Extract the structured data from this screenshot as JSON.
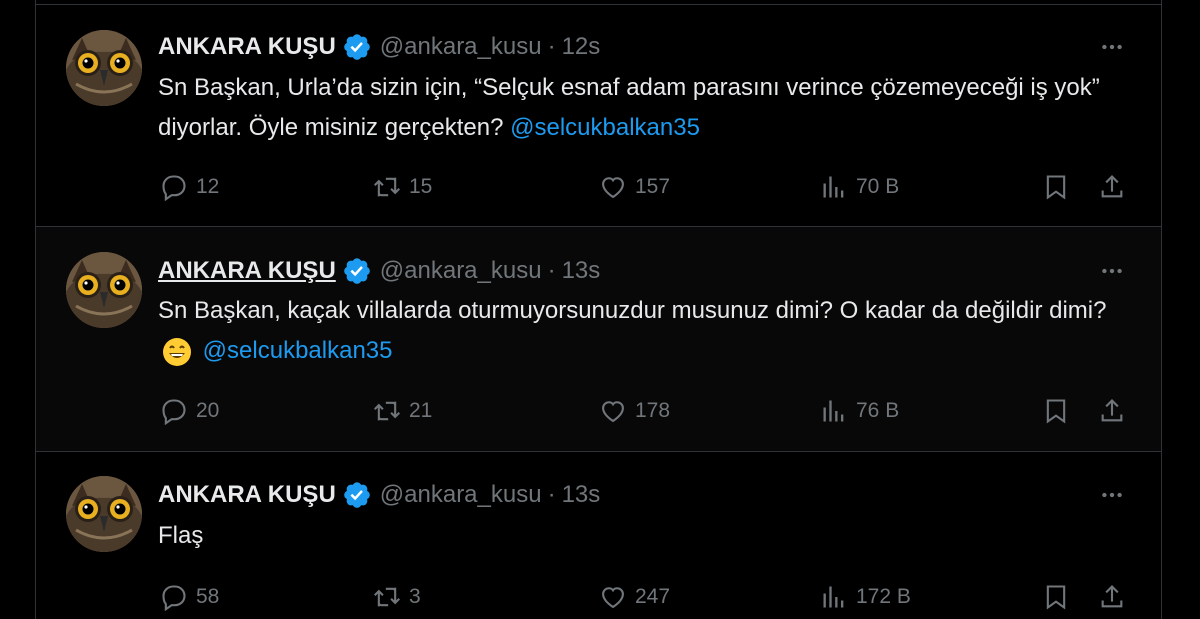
{
  "tweets": [
    {
      "name": "ANKARA KUŞU",
      "handle": "@ankara_kusu",
      "separator": "·",
      "time": "12s",
      "text_before": "Sn Başkan, Urla’da sizin için, “Selçuk esnaf adam parasını verince çözemeyeceği iş yok” diyorlar. Öyle misiniz gerçekten? ",
      "mention": "@selcukbalkan35",
      "replies": "12",
      "retweets": "15",
      "likes": "157",
      "views": "70 B"
    },
    {
      "name": "ANKARA KUŞU",
      "handle": "@ankara_kusu",
      "separator": "·",
      "time": "13s",
      "text_before": "Sn Başkan, kaçak villalarda oturmuyorsunuzdur musunuz dimi? O kadar da değildir dimi? ",
      "emoji": "grinning-face-emoji",
      "mention": "@selcukbalkan35",
      "replies": "20",
      "retweets": "21",
      "likes": "178",
      "views": "76 B"
    },
    {
      "name": "ANKARA KUŞU",
      "handle": "@ankara_kusu",
      "separator": "·",
      "time": "13s",
      "text_before": "Flaş",
      "mention": "",
      "replies": "58",
      "retweets": "3",
      "likes": "247",
      "views": "172 B"
    }
  ],
  "colors": {
    "accent": "#1d9bf0",
    "muted": "#71767b",
    "text": "#e7e9ea",
    "border": "#2f3336",
    "background": "#000000"
  },
  "icons": [
    "owl-avatar",
    "verified-badge-icon",
    "more-icon",
    "reply-icon",
    "retweet-icon",
    "like-icon",
    "views-icon",
    "bookmark-icon",
    "share-icon"
  ]
}
